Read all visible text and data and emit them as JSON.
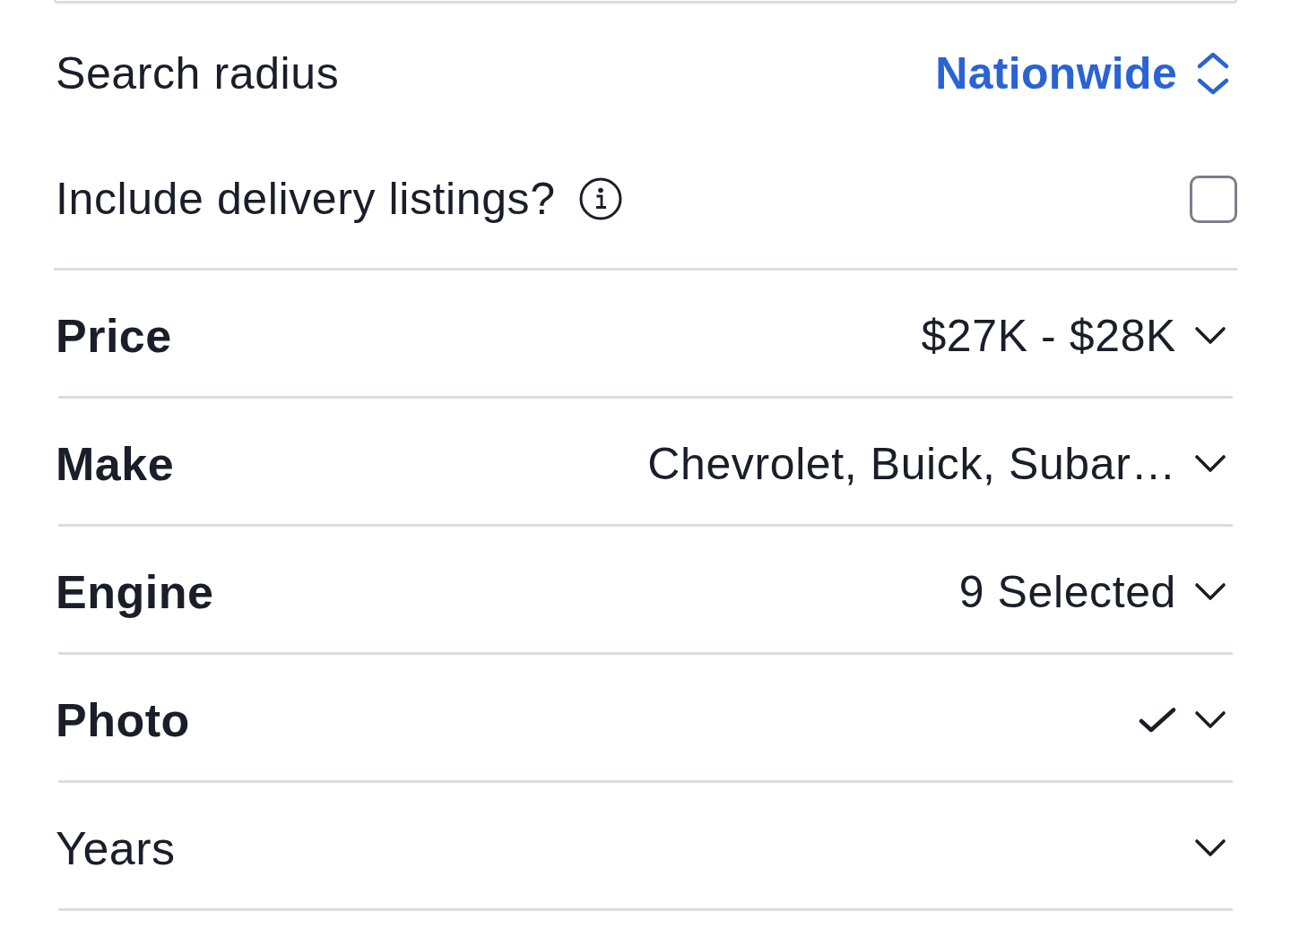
{
  "search_radius": {
    "label": "Search radius",
    "value": "Nationwide"
  },
  "delivery": {
    "label": "Include delivery listings?",
    "checked": false
  },
  "filters": [
    {
      "label": "Price",
      "active": true,
      "kind": "text",
      "value": "$27K - $28K"
    },
    {
      "label": "Make",
      "active": true,
      "kind": "text",
      "value": "Chevrolet, Buick, Subar…"
    },
    {
      "label": "Engine",
      "active": true,
      "kind": "text",
      "value": "9 Selected"
    },
    {
      "label": "Photo",
      "active": true,
      "kind": "check",
      "checked": true
    },
    {
      "label": "Years",
      "active": false,
      "kind": "empty"
    }
  ]
}
